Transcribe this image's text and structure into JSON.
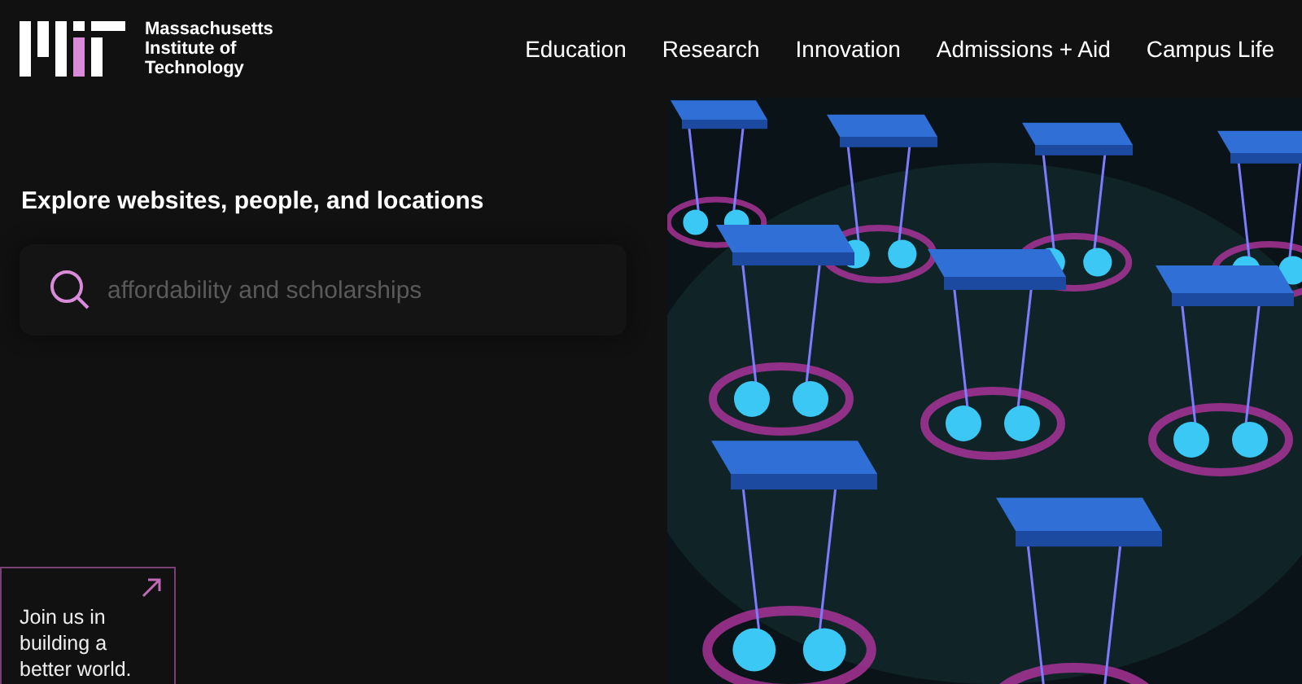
{
  "header": {
    "institution_name": "Massachusetts Institute of Technology",
    "nav": [
      {
        "label": "Education"
      },
      {
        "label": "Research"
      },
      {
        "label": "Innovation"
      },
      {
        "label": "Admissions + Aid"
      },
      {
        "label": "Campus Life"
      }
    ]
  },
  "search": {
    "heading": "Explore websites, people, and locations",
    "placeholder": "affordability and scholarships"
  },
  "promo": {
    "text": "Join us in building a better world."
  }
}
